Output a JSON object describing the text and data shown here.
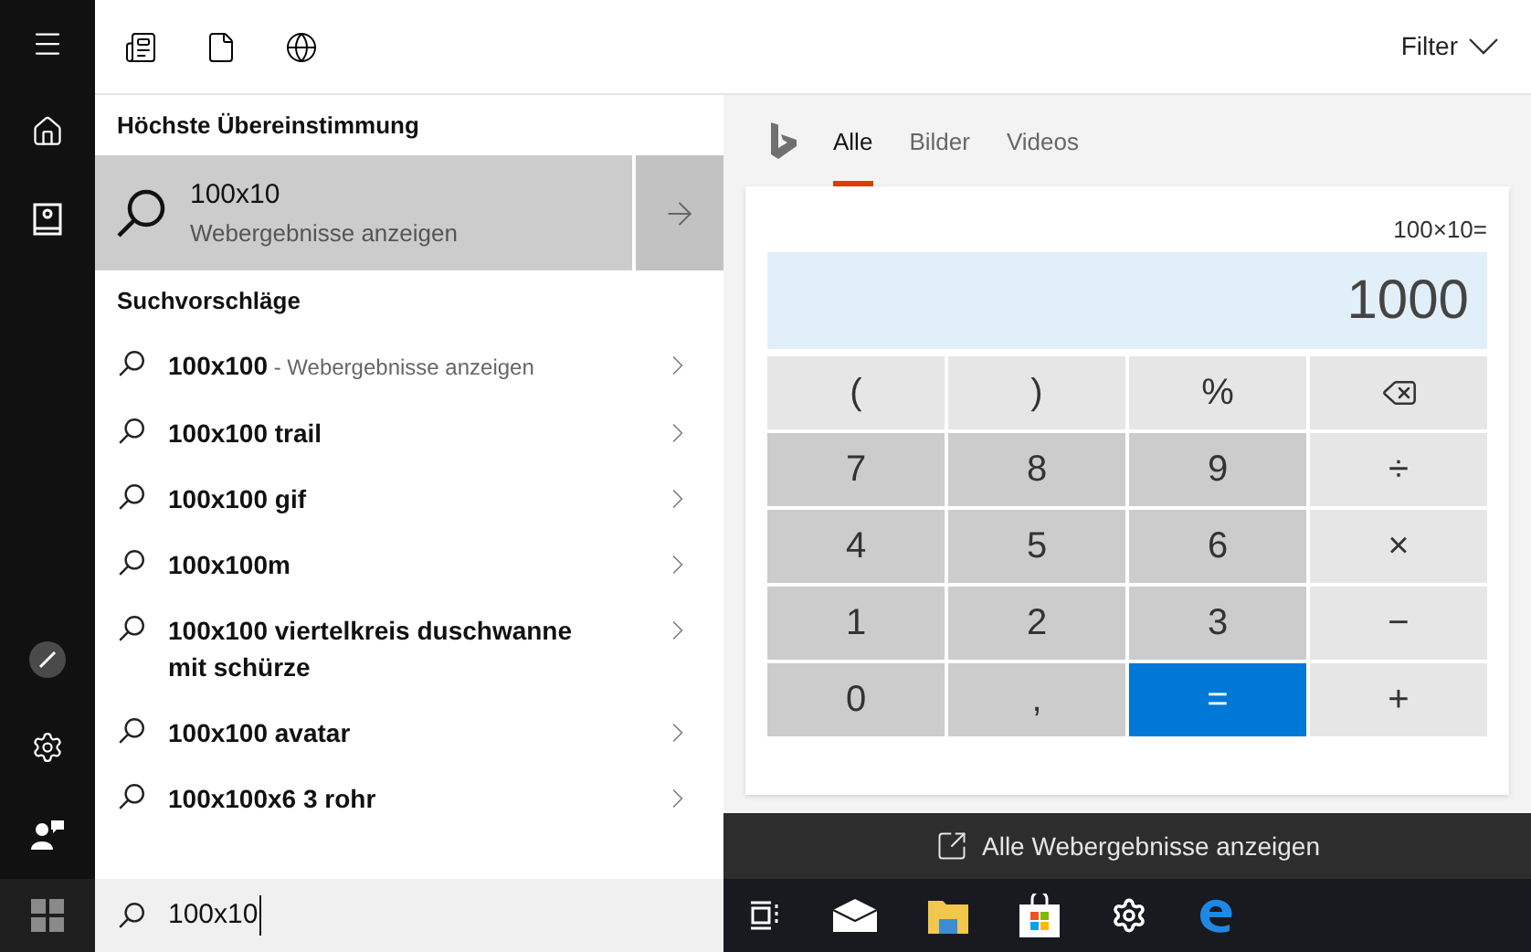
{
  "filter": {
    "label": "Filter"
  },
  "best_match": {
    "heading": "Höchste Übereinstimmung",
    "title": "100x10",
    "subtitle": "Webergebnisse anzeigen"
  },
  "suggestions": {
    "heading": "Suchvorschläge",
    "items": [
      {
        "text": "100x100",
        "note": "- Webergebnisse anzeigen"
      },
      {
        "text": "100x100 trail"
      },
      {
        "text": "100x100 gif"
      },
      {
        "text": "100x100m"
      },
      {
        "text": "100x100 viertelkreis duschwanne mit schürze"
      },
      {
        "text": "100x100 avatar"
      },
      {
        "text": "100x100x6 3 rohr"
      }
    ]
  },
  "search": {
    "value": "100x10"
  },
  "web_tabs": [
    {
      "label": "Alle",
      "selected": true
    },
    {
      "label": "Bilder",
      "selected": false
    },
    {
      "label": "Videos",
      "selected": false
    }
  ],
  "calculator": {
    "expression": "100×10=",
    "result": "1000",
    "keys": [
      {
        "kind": "op",
        "label": "("
      },
      {
        "kind": "op",
        "label": ")"
      },
      {
        "kind": "op",
        "label": "%"
      },
      {
        "kind": "backspace"
      },
      {
        "kind": "digit",
        "label": "7"
      },
      {
        "kind": "digit",
        "label": "8"
      },
      {
        "kind": "digit",
        "label": "9"
      },
      {
        "kind": "op",
        "label": "÷"
      },
      {
        "kind": "digit",
        "label": "4"
      },
      {
        "kind": "digit",
        "label": "5"
      },
      {
        "kind": "digit",
        "label": "6"
      },
      {
        "kind": "op",
        "label": "×"
      },
      {
        "kind": "digit",
        "label": "1"
      },
      {
        "kind": "digit",
        "label": "2"
      },
      {
        "kind": "digit",
        "label": "3"
      },
      {
        "kind": "op",
        "label": "−"
      },
      {
        "kind": "digit",
        "label": "0"
      },
      {
        "kind": "digit",
        "label": ","
      },
      {
        "kind": "equals",
        "label": "="
      },
      {
        "kind": "op",
        "label": "+"
      }
    ]
  },
  "all_results": {
    "label": "Alle Webergebnisse anzeigen"
  }
}
